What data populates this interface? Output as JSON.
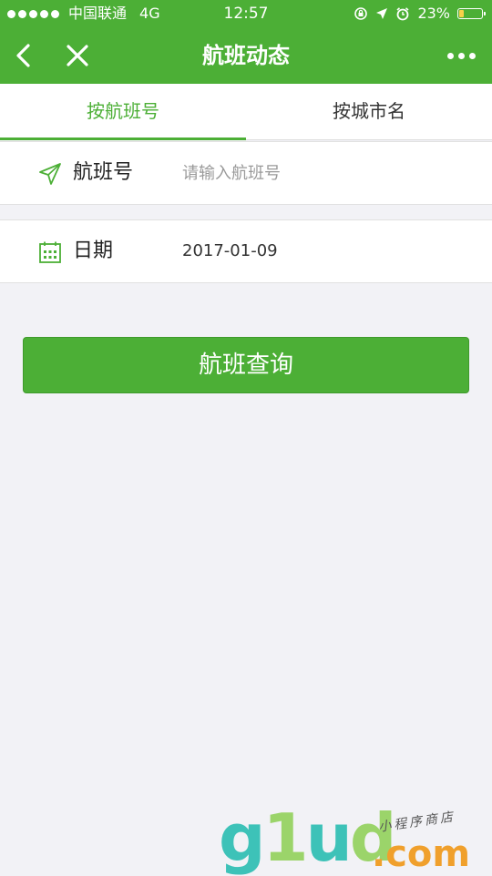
{
  "status_bar": {
    "carrier": "中国联通",
    "network": "4G",
    "time": "12:57",
    "battery_percent": "23%",
    "battery_level": 0.23
  },
  "nav": {
    "title": "航班动态"
  },
  "tabs": [
    {
      "label": "按航班号",
      "active": true
    },
    {
      "label": "按城市名",
      "active": false
    }
  ],
  "form": {
    "flight": {
      "label": "航班号",
      "placeholder": "请输入航班号",
      "value": ""
    },
    "date": {
      "label": "日期",
      "value": "2017-01-09"
    },
    "submit_label": "航班查询"
  },
  "watermark": {
    "logo": "g1ud",
    "domain": ".com",
    "tagline": "小程序商店"
  },
  "colors": {
    "accent": "#4caf36",
    "background": "#f2f2f6"
  }
}
